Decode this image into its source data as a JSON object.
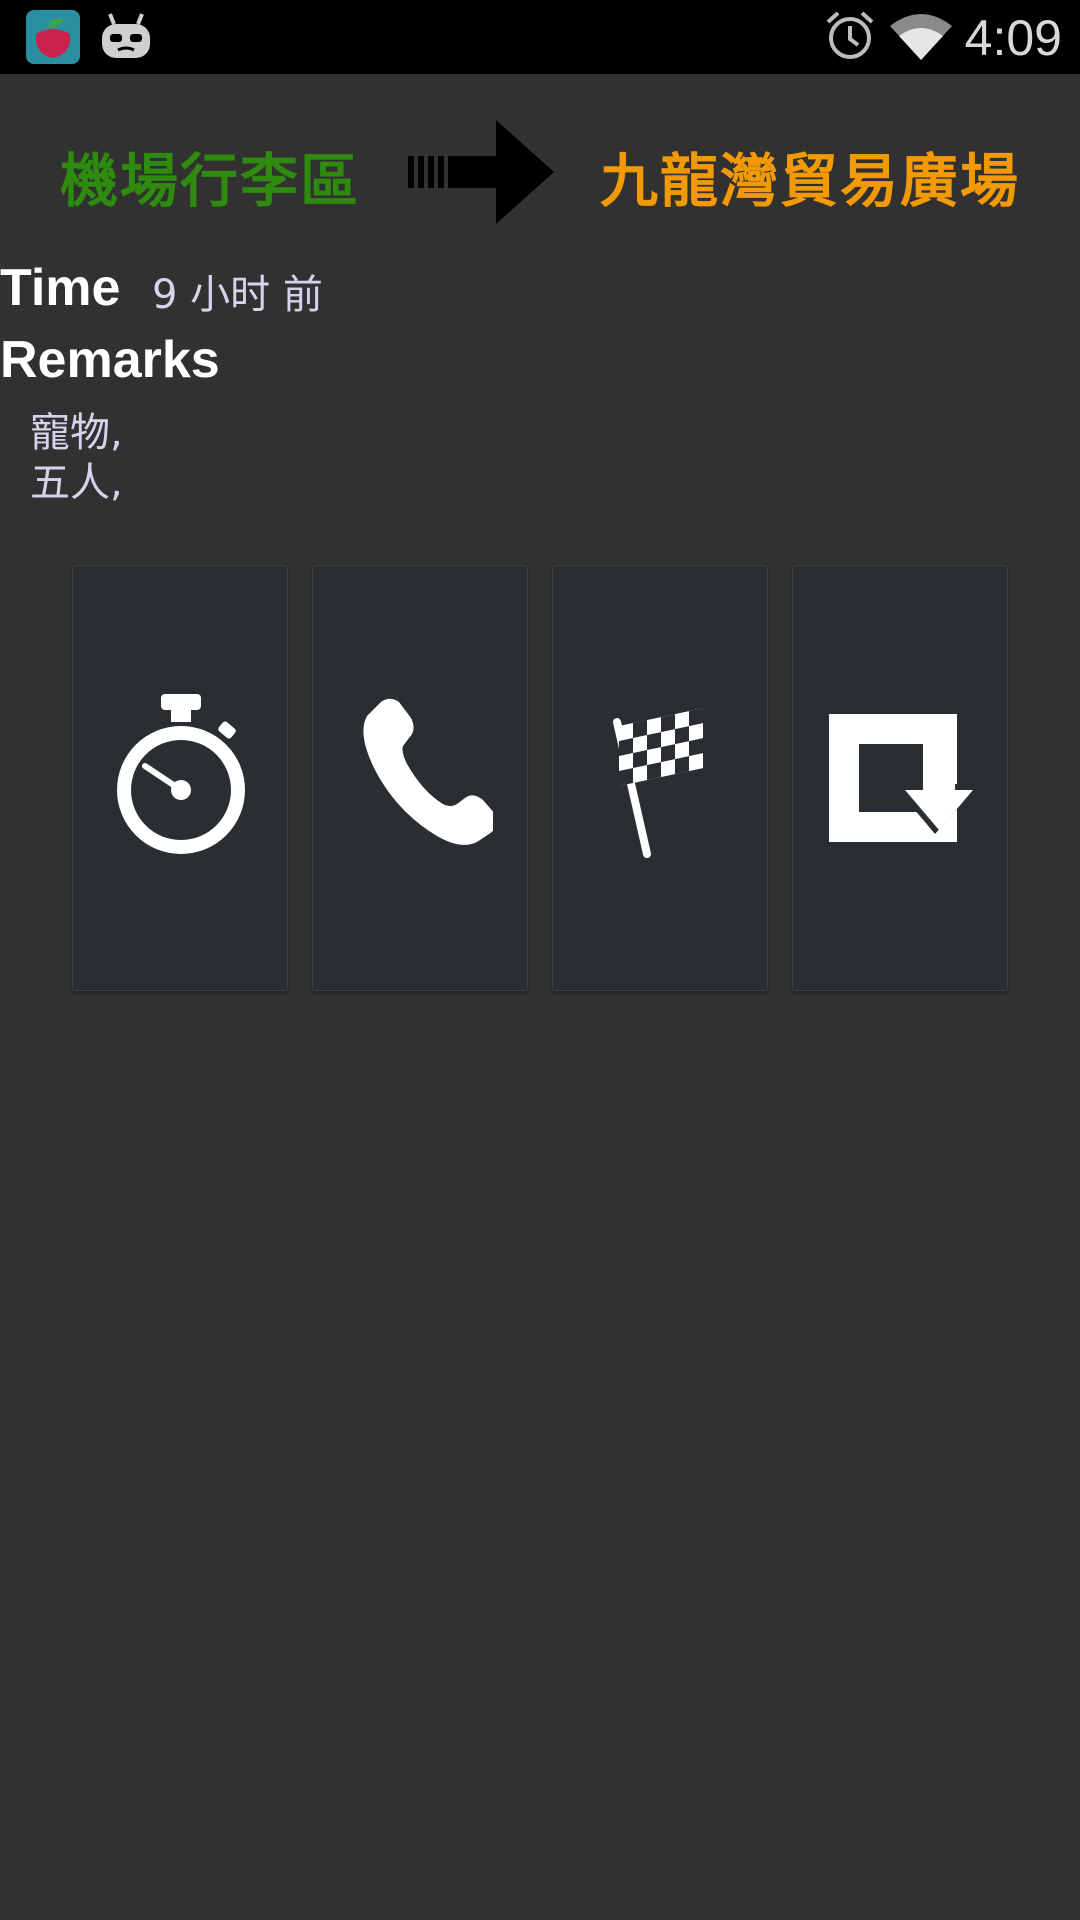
{
  "status_bar": {
    "time": "4:09",
    "icons": [
      "app-launcher-icon",
      "android-robot-icon",
      "alarm-clock-icon",
      "wifi-icon"
    ]
  },
  "route": {
    "from": "機場行李區",
    "to": "九龍灣貿易廣場",
    "from_color": "#2e8b0e",
    "to_color": "#f29a05",
    "arrow_icon": "right-arrow-icon"
  },
  "details": {
    "time_label": "Time",
    "time_value": "9 小时 前",
    "remarks_label": "Remarks",
    "remarks": [
      "寵物,",
      "五人,"
    ]
  },
  "actions": [
    {
      "name": "timer",
      "icon": "stopwatch-icon"
    },
    {
      "name": "call",
      "icon": "phone-icon"
    },
    {
      "name": "finish",
      "icon": "checkered-flag-icon"
    },
    {
      "name": "accept",
      "icon": "download-box-icon"
    }
  ],
  "colors": {
    "background": "#313131",
    "button_background": "#2a2e33",
    "text_secondary": "#d9d2ec"
  }
}
